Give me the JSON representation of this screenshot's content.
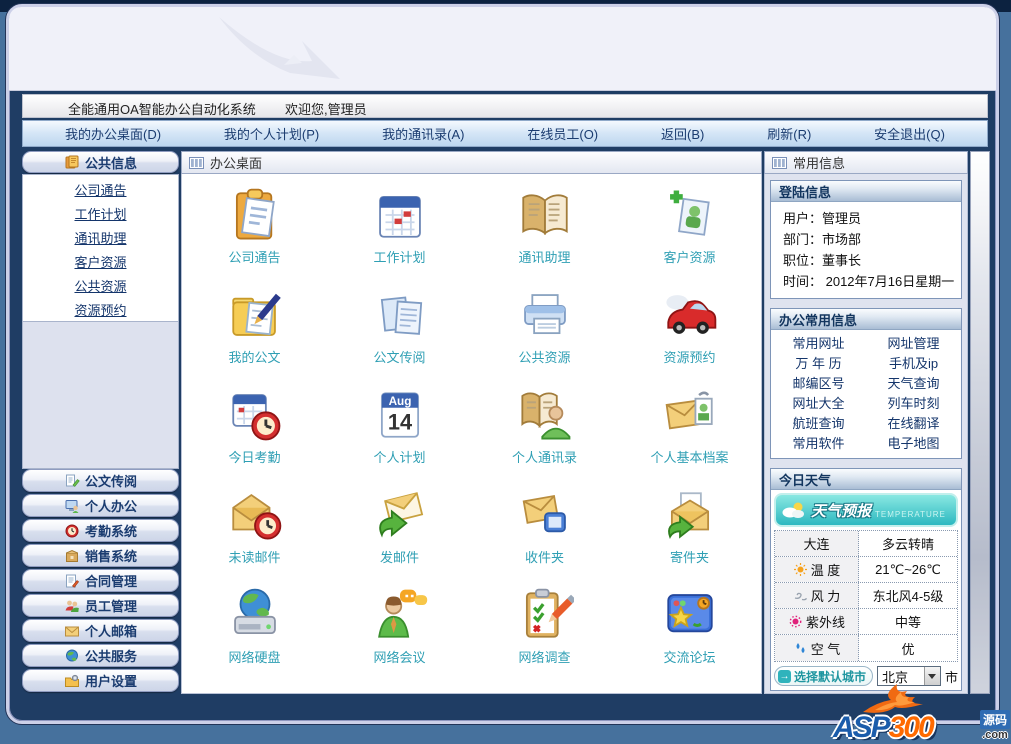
{
  "header": {
    "system_title": "全能通用OA智能办公自动化系统",
    "welcome": "欢迎您,管理员"
  },
  "menu": {
    "items": [
      "我的办公桌面(D)",
      "我的个人计划(P)",
      "我的通讯录(A)",
      "在线员工(O)",
      "返回(B)",
      "刷新(R)",
      "安全退出(Q)"
    ]
  },
  "sidebar": {
    "section": {
      "label": "公共信息",
      "icon": "books-icon"
    },
    "links": [
      "公司通告",
      "工作计划",
      "通讯助理",
      "客户资源",
      "公共资源",
      "资源预约"
    ],
    "buttons": [
      {
        "label": "公文传阅",
        "icon": "document-pencil-icon"
      },
      {
        "label": "个人办公",
        "icon": "monitor-person-icon"
      },
      {
        "label": "考勤系统",
        "icon": "clock-icon"
      },
      {
        "label": "销售系统",
        "icon": "package-icon"
      },
      {
        "label": "合同管理",
        "icon": "contract-pen-icon"
      },
      {
        "label": "员工管理",
        "icon": "people-icon"
      },
      {
        "label": "个人邮箱",
        "icon": "envelope-icon"
      },
      {
        "label": "公共服务",
        "icon": "globe-icon"
      },
      {
        "label": "用户设置",
        "icon": "folder-gear-icon"
      }
    ]
  },
  "desktop": {
    "title": "办公桌面",
    "title_icon": "grid-icon",
    "aug_icon": {
      "month": "Aug",
      "day": "14"
    },
    "items": [
      {
        "label": "公司通告",
        "icon": "clipboard-icon"
      },
      {
        "label": "工作计划",
        "icon": "calendar-icon"
      },
      {
        "label": "通讯助理",
        "icon": "address-book-icon"
      },
      {
        "label": "客户资源",
        "icon": "customer-card-icon"
      },
      {
        "label": "我的公文",
        "icon": "folder-pen-icon"
      },
      {
        "label": "公文传阅",
        "icon": "documents-icon"
      },
      {
        "label": "公共资源",
        "icon": "printer-icon"
      },
      {
        "label": "资源预约",
        "icon": "car-icon"
      },
      {
        "label": "今日考勤",
        "icon": "calendar-clock-icon"
      },
      {
        "label": "个人计划",
        "icon": "calendar-aug-icon"
      },
      {
        "label": "个人通讯录",
        "icon": "contacts-book-icon"
      },
      {
        "label": "个人基本档案",
        "icon": "profile-envelope-icon"
      },
      {
        "label": "未读邮件",
        "icon": "unread-mail-icon"
      },
      {
        "label": "发邮件",
        "icon": "send-mail-icon"
      },
      {
        "label": "收件夹",
        "icon": "inbox-icon"
      },
      {
        "label": "寄件夹",
        "icon": "outbox-icon"
      },
      {
        "label": "网络硬盘",
        "icon": "network-disk-icon"
      },
      {
        "label": "网络会议",
        "icon": "meeting-icon"
      },
      {
        "label": "网络调查",
        "icon": "survey-icon"
      },
      {
        "label": "交流论坛",
        "icon": "forum-icon"
      }
    ]
  },
  "info_panel": {
    "title": "常用信息",
    "login": {
      "title": "登陆信息",
      "rows": [
        "用户：管理员",
        "部门：市场部",
        "职位：董事长",
        "时间： 2012年7月16日星期一"
      ]
    },
    "common": {
      "title": "办公常用信息",
      "pairs": [
        [
          "常用网址",
          "网址管理"
        ],
        [
          "万 年 历",
          "手机及ip"
        ],
        [
          "邮编区号",
          "天气查询"
        ],
        [
          "网址大全",
          "列车时刻"
        ],
        [
          "航班查询",
          "在线翻译"
        ],
        [
          "常用软件",
          "电子地图"
        ]
      ]
    },
    "weather": {
      "title": "今日天气",
      "banner": {
        "label": "天气预报",
        "sub": "TEMPERATURE",
        "icon": "cloud-sun-icon"
      },
      "rows": [
        {
          "icon": "",
          "label": "大连",
          "value": "多云转晴"
        },
        {
          "icon": "sun-icon",
          "label": "温 度",
          "value": "21℃~26℃"
        },
        {
          "icon": "wind-icon",
          "label": "风 力",
          "value": "东北风4-5级"
        },
        {
          "icon": "uv-icon",
          "label": "紫外线",
          "value": "中等"
        },
        {
          "icon": "drops-icon",
          "label": "空 气",
          "value": "优"
        }
      ],
      "city": {
        "button": "选择默认城市",
        "button_icon": "arrow-right-icon",
        "selected": "北京",
        "suffix": "市"
      }
    }
  },
  "watermark": {
    "asp": "ASP",
    "n300": "300",
    "tag": "源码",
    "com": ".com"
  },
  "colors": {
    "caption_teal": "#2f9fb4",
    "navy_text": "#16356b",
    "banner_teal": "#2cb8c0",
    "desktop_blue": "#46719d"
  }
}
